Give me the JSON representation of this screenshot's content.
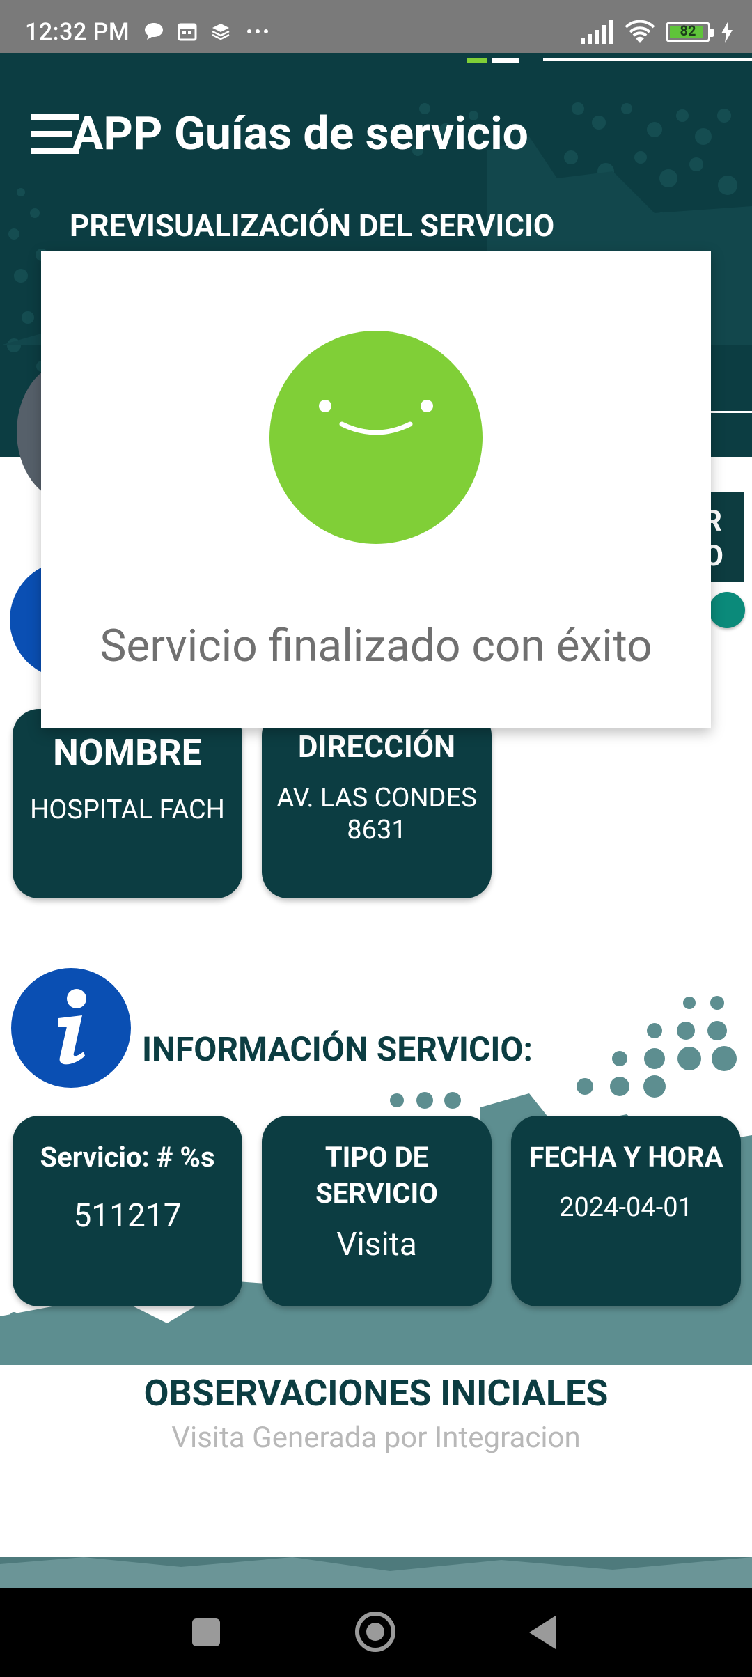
{
  "status_bar": {
    "time": "12:32 PM",
    "battery": "82",
    "icons": [
      "chat-icon",
      "calendar-icon",
      "layers-icon",
      "more-icon",
      "signal-icon",
      "wifi-icon",
      "battery-icon",
      "charging-icon"
    ]
  },
  "header": {
    "app_title": "APP Guías de servicio",
    "subtitle": "PREVISUALIZACIÓN DEL SERVICIO",
    "side_button_text": "R\nO"
  },
  "client": {
    "nombre_label": "NOMBRE",
    "nombre_value": "HOSPITAL FACH",
    "direccion_label": "DIRECCIÓN",
    "direccion_value": "AV. LAS CONDES 8631"
  },
  "service_info": {
    "heading": "INFORMACIÓN SERVICIO:",
    "servicio_label": "Servicio: # %s",
    "servicio_value": "511217",
    "tipo_label": "TIPO DE SERVICIO",
    "tipo_value": "Visita",
    "fecha_label": "FECHA Y HORA",
    "fecha_value": "2024-04-01"
  },
  "observations": {
    "title": "OBSERVACIONES INICIALES",
    "text": "Visita Generada por Integracion"
  },
  "dialog": {
    "message": "Servicio finalizado con éxito",
    "icon": "smiley-face-icon"
  },
  "colors": {
    "primary_dark": "#0c3d42",
    "info_blue": "#0a4fb3",
    "success_green": "#80cf37",
    "teal_accent": "#0b8a7a"
  }
}
